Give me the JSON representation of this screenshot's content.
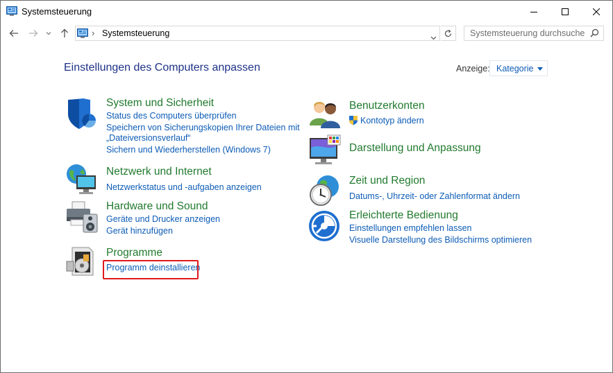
{
  "window": {
    "title": "Systemsteuerung",
    "controls": {
      "minimize_icon": "minimize-icon",
      "maximize_icon": "maximize-icon",
      "close_icon": "close-icon"
    }
  },
  "navbar": {
    "back_icon": "arrow-left-icon",
    "forward_icon": "arrow-right-icon",
    "recent_icon": "chevron-down-icon",
    "up_icon": "arrow-up-icon",
    "address": {
      "separator": "›",
      "path": "Systemsteuerung"
    },
    "search": {
      "placeholder": "Systemsteuerung durchsuchen"
    }
  },
  "main": {
    "heading": "Einstellungen des Computers anpassen",
    "view": {
      "label": "Anzeige:",
      "selected": "Kategorie"
    },
    "categories_left": [
      {
        "title": "System und Sicherheit",
        "icon": "shield-icon",
        "links": [
          "Status des Computers überprüfen",
          "Speichern von Sicherungskopien Ihrer Dateien mit",
          "„Dateiversionsverlauf“",
          "Sichern und Wiederherstellen (Windows 7)"
        ]
      },
      {
        "title": "Netzwerk und Internet",
        "icon": "network-globe-icon",
        "links": [
          "Netzwerkstatus und -aufgaben anzeigen"
        ]
      },
      {
        "title": "Hardware und Sound",
        "icon": "printer-speaker-icon",
        "links": [
          "Geräte und Drucker anzeigen",
          "Gerät hinzufügen"
        ]
      },
      {
        "title": "Programme",
        "icon": "programs-disc-icon",
        "links": [
          "Programm deinstallieren"
        ]
      }
    ],
    "categories_right": [
      {
        "title": "Benutzerkonten",
        "icon": "users-icon",
        "links": [
          "Kontotyp ändern"
        ],
        "link_icon": "uac-shield-icon"
      },
      {
        "title": "Darstellung und Anpassung",
        "icon": "display-palette-icon",
        "links": []
      },
      {
        "title": "Zeit und Region",
        "icon": "clock-globe-icon",
        "links": [
          "Datums-, Uhrzeit- oder Zahlenformat ändern"
        ]
      },
      {
        "title": "Erleichterte Bedienung",
        "icon": "accessibility-icon",
        "links": [
          "Einstellungen empfehlen lassen",
          "Visuelle Darstellung des Bildschirms optimieren"
        ]
      }
    ]
  },
  "colors": {
    "category_title": "#217a2e",
    "link": "#0d5cb6",
    "heading": "#1e3287",
    "highlight": "#e0191b"
  }
}
